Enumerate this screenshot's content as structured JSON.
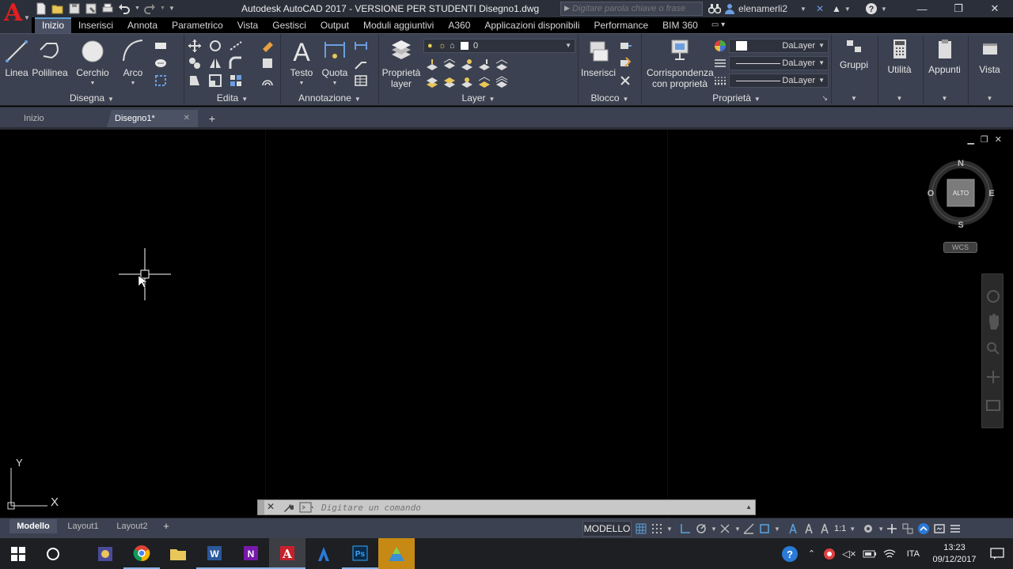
{
  "titlebar": {
    "document_title": "Autodesk AutoCAD 2017 - VERSIONE PER STUDENTI    Disegno1.dwg",
    "search_placeholder": "Digitare parola chiave o frase",
    "username": "elenamerli2"
  },
  "ribbon_tabs": [
    "Inizio",
    "Inserisci",
    "Annota",
    "Parametrico",
    "Vista",
    "Gestisci",
    "Output",
    "Moduli aggiuntivi",
    "A360",
    "Applicazioni disponibili",
    "Performance",
    "BIM 360"
  ],
  "active_tab": "Inizio",
  "ribbon": {
    "disegna": {
      "title": "Disegna",
      "linea": "Linea",
      "polilinea": "Polilinea",
      "cerchio": "Cerchio",
      "arco": "Arco"
    },
    "edita": {
      "title": "Edita"
    },
    "annotazione": {
      "title": "Annotazione",
      "testo": "Testo",
      "quota": "Quota"
    },
    "layer": {
      "title": "Layer",
      "proprieta_layer": "Proprietà layer",
      "current_layer": "0"
    },
    "blocco": {
      "title": "Blocco",
      "inserisci": "Inserisci"
    },
    "proprieta": {
      "title": "Proprietà",
      "corrispondenza": "Corrispondenza con proprietà",
      "color_value": "DaLayer",
      "linetype_value": "DaLayer",
      "lineweight_value": "DaLayer"
    },
    "gruppi": "Gruppi",
    "utilita": "Utilità",
    "appunti": "Appunti",
    "vista": "Vista"
  },
  "file_tabs": {
    "start": "Inizio",
    "current": "Disegno1*"
  },
  "viewcube": {
    "north": "N",
    "south": "S",
    "east": "E",
    "west": "O",
    "face": "ALTO",
    "wcs": "WCS"
  },
  "ucs": {
    "y": "Y",
    "x": "X"
  },
  "command_line": {
    "placeholder": "Digitare un comando"
  },
  "layout_tabs": [
    "Modello",
    "Layout1",
    "Layout2"
  ],
  "status_bar": {
    "space": "MODELLO",
    "scale": "1:1"
  },
  "taskbar": {
    "language": "ITA",
    "time": "13:23",
    "date": "09/12/2017"
  },
  "colors": {
    "accent": "#5a9fd9",
    "ribbon_bg": "#3b4150",
    "canvas_bg": "#000000",
    "autocad_red": "#e02020"
  }
}
